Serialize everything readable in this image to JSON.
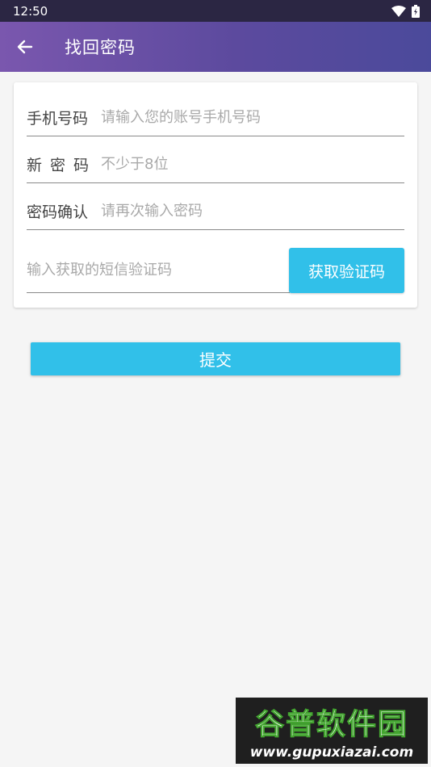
{
  "status_bar": {
    "time": "12:50",
    "icons": [
      "wifi-icon",
      "battery-icon"
    ]
  },
  "app_bar": {
    "back_icon": "arrow-left-icon",
    "title": "找回密码",
    "gradient_colors": [
      "#7a57ae",
      "#4b4a9b"
    ]
  },
  "form": {
    "phone": {
      "label": "手机号码",
      "placeholder": "请输入您的账号手机号码",
      "value": ""
    },
    "new_password": {
      "label": "新密码",
      "placeholder": "不少于8位",
      "value": ""
    },
    "confirm_password": {
      "label": "密码确认",
      "placeholder": "请再次输入密码",
      "value": ""
    },
    "sms_code": {
      "placeholder": "输入获取的短信验证码",
      "value": ""
    },
    "get_code_label": "获取验证码"
  },
  "submit_label": "提交",
  "watermark": {
    "title": "谷普软件园",
    "url": "www.gupuxiazai.com"
  },
  "colors": {
    "accent": "#31c0e9",
    "status_bar": "#2b2643",
    "background": "#f5f5f5"
  }
}
